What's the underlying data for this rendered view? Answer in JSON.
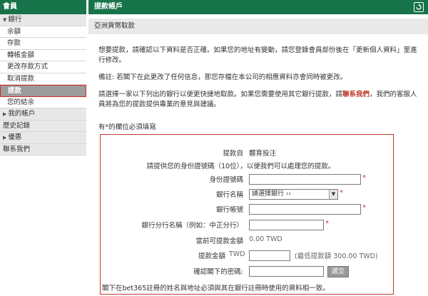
{
  "sidebar": {
    "header": "會員",
    "items": [
      {
        "label": "銀行",
        "type": "group",
        "expanded": true
      },
      {
        "label": "余額",
        "type": "sub"
      },
      {
        "label": "存款",
        "type": "sub"
      },
      {
        "label": "轉帳金額",
        "type": "sub"
      },
      {
        "label": "更改存款方式",
        "type": "sub"
      },
      {
        "label": "取消提款",
        "type": "sub"
      },
      {
        "label": "提款",
        "type": "active"
      },
      {
        "label": "您的結余",
        "type": "sub"
      },
      {
        "label": "我的帳戶",
        "type": "group"
      },
      {
        "label": "歷史記錄",
        "type": "plain"
      },
      {
        "label": "優惠",
        "type": "group"
      },
      {
        "label": "聯系我們",
        "type": "plain"
      }
    ]
  },
  "main": {
    "title": "提款帳戶",
    "subtitle": "亞洲貨幣取款",
    "para1": "想要提款，請確認以下資料是否正確。如果您的地址有變動，請您登錄會員部份後在「更新個人資料」里進行修改。",
    "para2": "備註: 若閣下在此更改了任何信息，那您存檔在本公司的相應資料亦會同時被更改。",
    "para3_before": "請選擇一家以下列出的銀行以便更快捷地取款。如果您需要使用其它銀行提款，請",
    "para3_link": "聯系我們",
    "para3_after": "，我們的客服人員將為您的提款提供專業的意見與建議。",
    "required_note": "有*的欄位必須填寫"
  },
  "form": {
    "source_label": "提款自",
    "source_value": "體育投注",
    "id_notice": "請提供您的身份證號碼（10位），以便我們可以處理您的提款。",
    "id_label": "身份證號碼",
    "bank_label": "銀行名稱",
    "bank_select": "請選擇銀行 ››",
    "account_label": "銀行帳號",
    "branch_label": "銀行分行名稱（例如：中正分行）",
    "available_label": "當前可提款金額",
    "available_value": "0.00 TWD",
    "amount_label": "提款金額",
    "amount_currency": "TWD",
    "min_note": "(最低提款額 300.00 TWD)",
    "password_label": "確認閣下的密碼:",
    "submit": "遞交",
    "footnote": "閣下在bet365註冊的姓名與地址必須與其在銀行註冊時使用的資料相一致。",
    "required_mark": "*"
  }
}
